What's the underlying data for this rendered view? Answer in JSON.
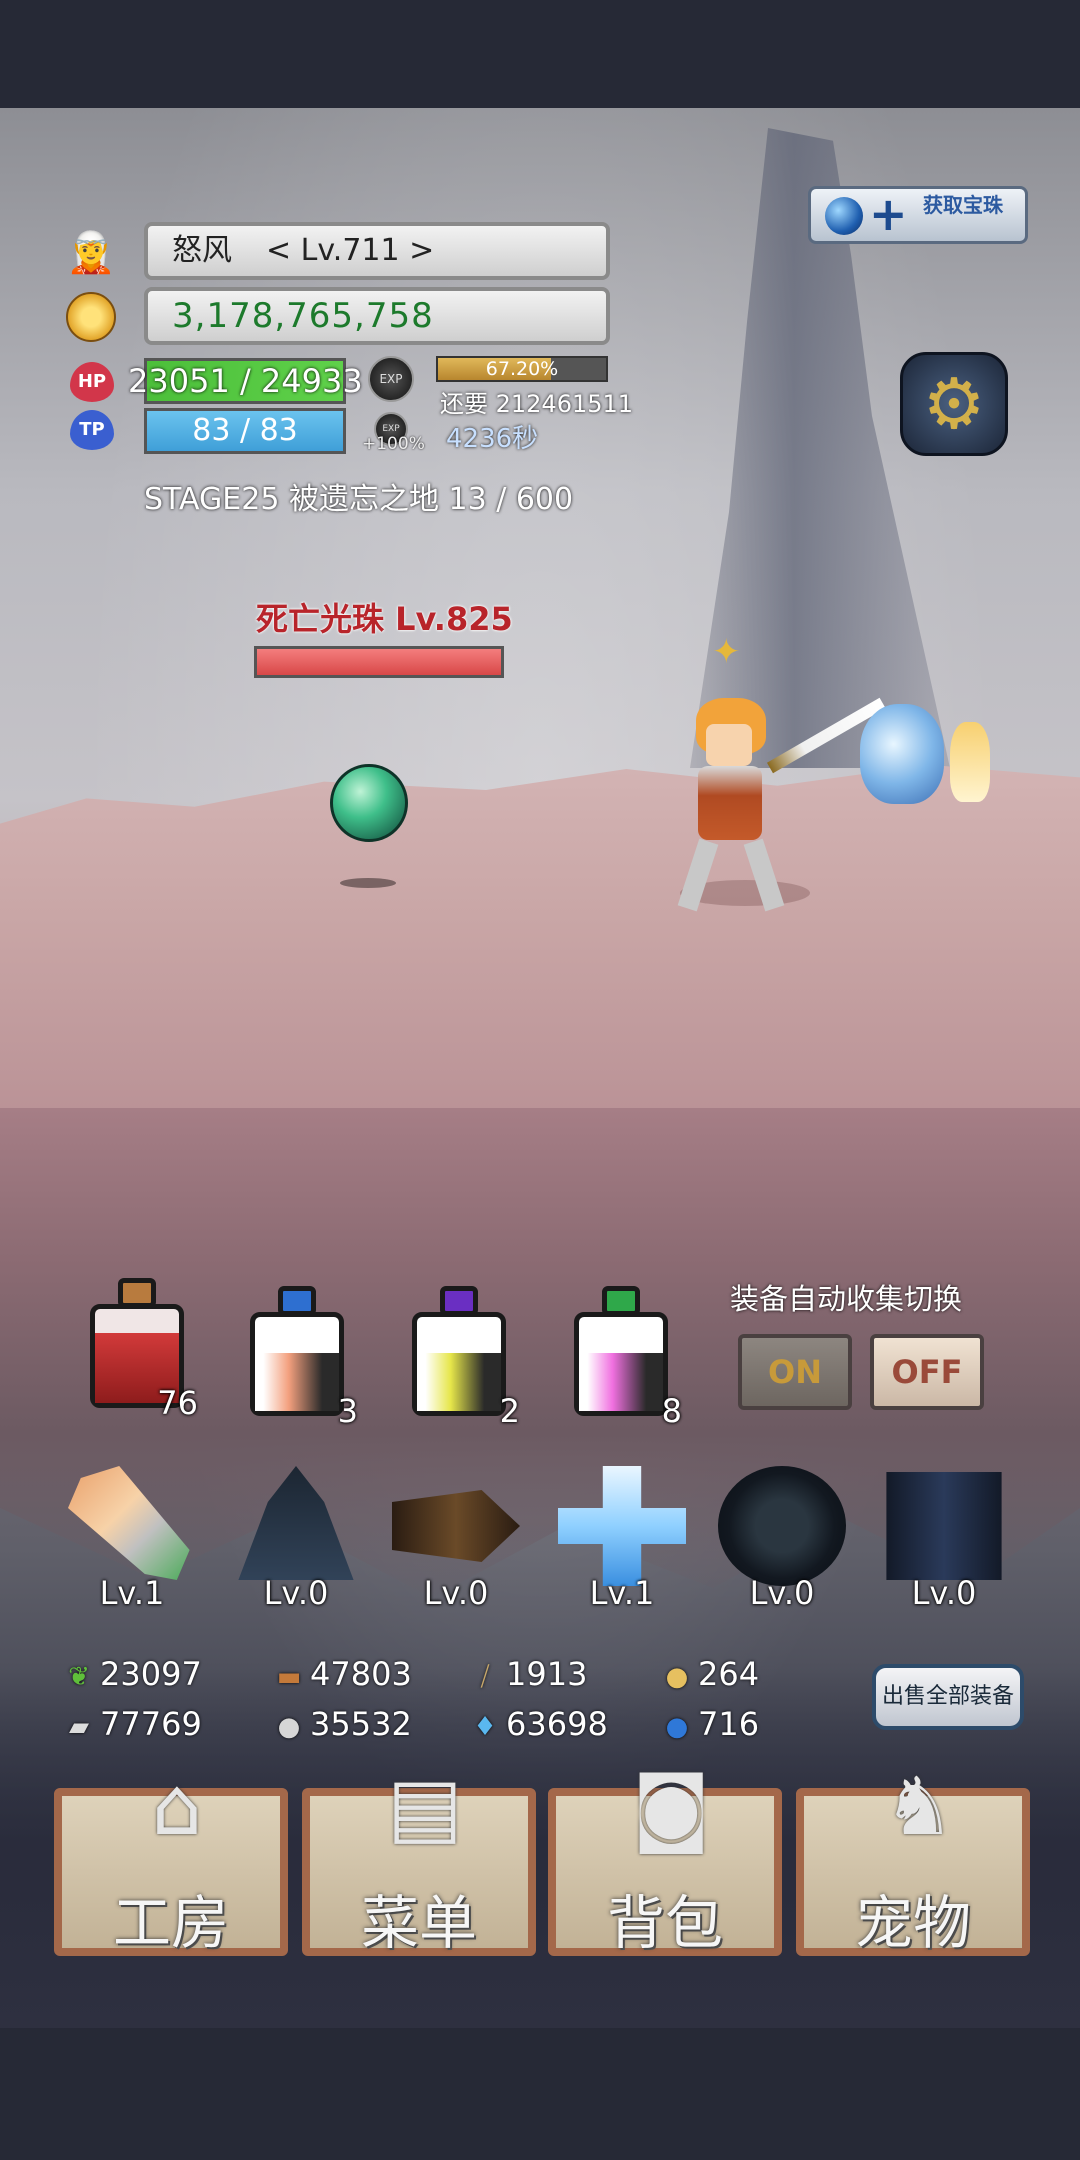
{
  "player": {
    "name": "怒风",
    "level": "< Lv.711 >",
    "gold": "3,178,765,758",
    "hp": "23051 / 24933",
    "tp": "83 / 83",
    "hp_label": "HP",
    "tp_label": "TP",
    "exp_label": "EXP",
    "exp_percent": "67.20%",
    "exp_fraction": 0.672,
    "exp_remaining": "还要 212461511",
    "exp_bonus": "+100%",
    "exp_time": "4236秒",
    "stage": "STAGE25 被遗忘之地 13 / 600"
  },
  "get_gem_button": {
    "label": "获取宝珠",
    "icon": "gem-plus-icon"
  },
  "settings_button": {
    "icon": "gear-icon"
  },
  "enemy": {
    "name": "死亡光珠 Lv.825",
    "hp_fraction": 1.0
  },
  "potions": [
    {
      "icon": "red-potion-icon",
      "count": "76"
    },
    {
      "icon": "orange-potion-icon",
      "count": "3"
    },
    {
      "icon": "yellow-potion-icon",
      "count": "2"
    },
    {
      "icon": "pink-potion-icon",
      "count": "8"
    }
  ],
  "auto_collect": {
    "title": "装备自动收集切换",
    "on_label": "ON",
    "off_label": "OFF"
  },
  "equipment": [
    {
      "icon": "feather-sword-icon",
      "level": "Lv.1"
    },
    {
      "icon": "dark-armor-icon",
      "level": "Lv.0"
    },
    {
      "icon": "dark-arrow-icon",
      "level": "Lv.0"
    },
    {
      "icon": "ice-cross-icon",
      "level": "Lv.1"
    },
    {
      "icon": "dark-ring-icon",
      "level": "Lv.0"
    },
    {
      "icon": "dark-gauntlet-icon",
      "level": "Lv.0"
    }
  ],
  "resources": {
    "herb": "23097",
    "wood": "47803",
    "plank": "1913",
    "drop": "264",
    "iron": "77769",
    "stone": "35532",
    "flame": "63698",
    "gem": "716"
  },
  "sell_all_label": "出售全部装备",
  "menu": {
    "workshop": "工房",
    "menu": "菜单",
    "bag": "背包",
    "pet": "宠物"
  },
  "colors": {
    "hp_bar": "#4cbf3a",
    "tp_bar": "#3f9fd8",
    "enemy_name": "#b8242a",
    "menu_frame": "#a4684a"
  }
}
